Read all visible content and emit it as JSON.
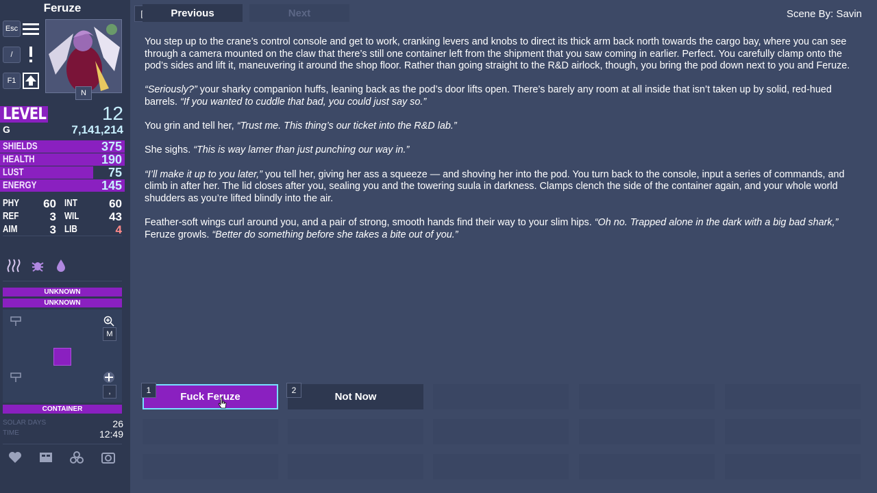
{
  "character": {
    "name": "Feruze",
    "keys": {
      "esc": "Esc",
      "slash": "/",
      "f1": "F1",
      "n": "N"
    },
    "level_label": "LEVEL",
    "level": "12",
    "credits_icon": "G",
    "credits": "7,141,214",
    "stats": [
      {
        "label": "SHIELDS",
        "value": "375",
        "fill": 1.0
      },
      {
        "label": "HEALTH",
        "value": "190",
        "fill": 1.0
      },
      {
        "label": "LUST",
        "value": "75",
        "fill": 0.75
      },
      {
        "label": "ENERGY",
        "value": "145",
        "fill": 1.0
      }
    ],
    "attributes": [
      {
        "l1": "PHY",
        "v1": "60",
        "l2": "INT",
        "v2": "60"
      },
      {
        "l1": "REF",
        "v1": "3",
        "l2": "WIL",
        "v2": "43"
      },
      {
        "l1": "AIM",
        "v1": "3",
        "l2": "LIB",
        "v2": "4"
      }
    ]
  },
  "location": {
    "line1": "UNKNOWN",
    "line2": "UNKNOWN",
    "container": "CONTAINER",
    "map_key": "M",
    "map_key2": ","
  },
  "time": {
    "days_label": "SOLAR DAYS",
    "days": "26",
    "time_label": "TIME",
    "clock": "12:49"
  },
  "nav": {
    "bracket": "[",
    "previous": "Previous",
    "next": "Next",
    "scene_by": "Scene By: Savin"
  },
  "story": {
    "p1": "You step up to the crane’s control console and get to work, cranking levers and knobs to direct its thick arm back north towards the cargo bay, where you can see through a camera mounted on the claw that there’s still one container left from the shipment that you saw coming in earlier. Perfect. You carefully clamp onto the pod’s sides and lift it, maneuvering it around the shop floor. Rather than going straight to the R&D airlock, though, you bring the pod down next to you and Feruze.",
    "p2a": "“Seriously?”",
    "p2b": " your sharky companion huffs, leaning back as the pod’s door lifts open. There’s barely any room at all inside that isn’t taken up by solid, red-hued barrels. ",
    "p2c": "“If you wanted to cuddle that bad, you could just say so.”",
    "p3a": "You grin and tell her, ",
    "p3b": "“Trust me. This thing’s our ticket into the R&D lab.”",
    "p4a": "She sighs. ",
    "p4b": "“This is way lamer than just punching our way in.”",
    "p5a": "“I’ll make it up to you later,”",
    "p5b": " you tell her, giving her ass a squeeze — and shoving her into the pod. You turn back to the console, input a series of commands, and climb in after her. The lid closes after you, sealing you and the towering suula in darkness. Clamps clench the side of the container again, and your whole world shudders as you’re lifted blindly into the air.",
    "p6a": "Feather-soft wings curl around you, and a pair of strong, smooth hands find their way to your slim hips. ",
    "p6b": "“Oh no. Trapped alone in the dark with a big bad shark,”",
    "p6c": " Feruze growls. ",
    "p6d": "“Better do something before she takes a bite out of you.”"
  },
  "choices": [
    {
      "num": "1",
      "label": "Fuck Feruze"
    },
    {
      "num": "2",
      "label": "Not Now"
    }
  ],
  "colors": {
    "accent": "#8a20c0",
    "highlight_border": "#78e0ff",
    "panel": "#2e3850",
    "background": "#3d4966"
  }
}
